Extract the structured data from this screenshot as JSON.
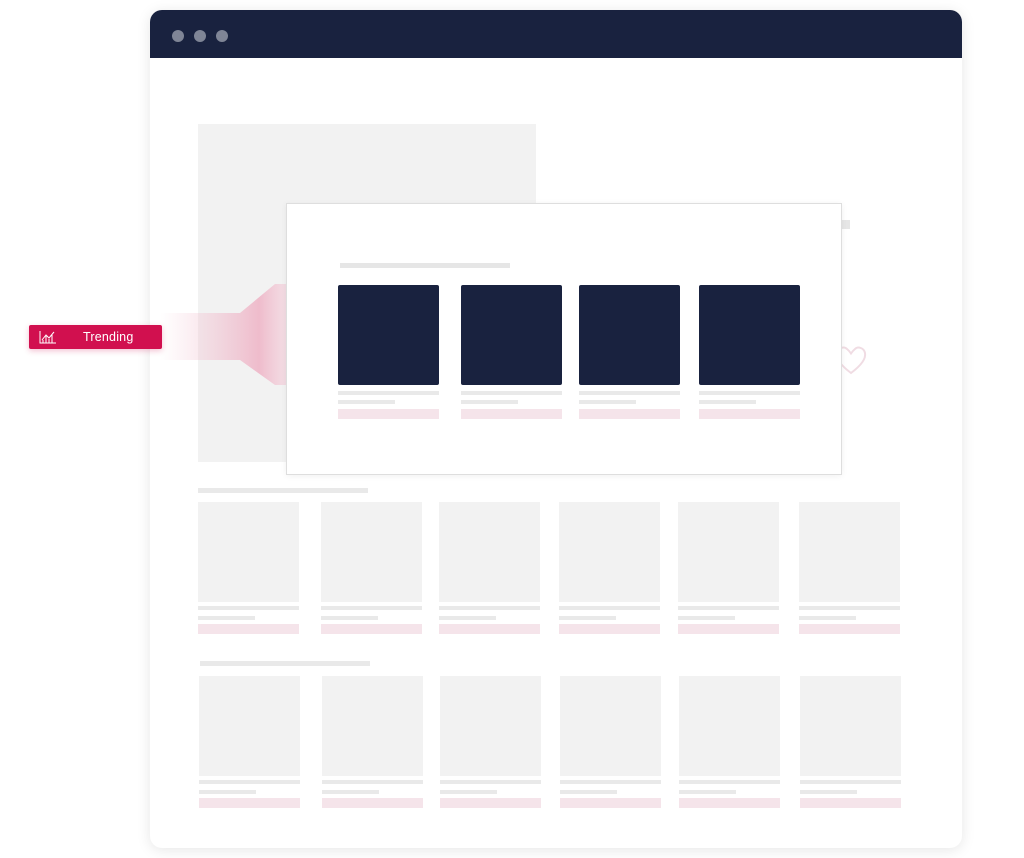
{
  "window": {
    "titlebar_color": "#19223f",
    "controls": [
      "window-dot",
      "window-dot",
      "window-dot"
    ]
  },
  "badge": {
    "label": "Trending",
    "icon": "trending-chart-icon",
    "color": "#d1104f"
  },
  "overlay": {
    "cards": [
      {
        "icon": "product-thumbnail"
      },
      {
        "icon": "product-thumbnail"
      },
      {
        "icon": "product-thumbnail"
      },
      {
        "icon": "product-thumbnail"
      }
    ]
  },
  "rows": [
    {
      "items": 6
    },
    {
      "items": 6
    }
  ],
  "colors": {
    "dark": "#19223f",
    "accent": "#d1104f",
    "placeholder": "#f2f2f2",
    "price_bar": "#f5e4ea"
  }
}
